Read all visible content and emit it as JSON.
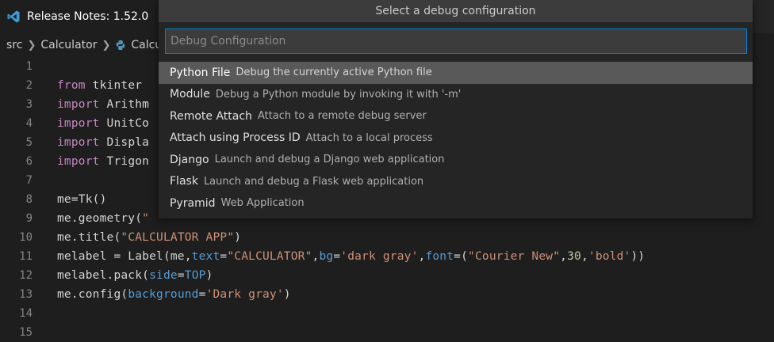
{
  "tab": {
    "title": "Release Notes: 1.52.0"
  },
  "breadcrumb": {
    "folder1": "src",
    "folder2": "Calculator",
    "file_partial": "Calcu"
  },
  "editor": {
    "lines": [
      {
        "n": "1",
        "segs": []
      },
      {
        "n": "2",
        "segs": [
          {
            "t": "from",
            "c": "kw"
          },
          {
            "t": " tkinter ",
            "c": ""
          }
        ]
      },
      {
        "n": "3",
        "segs": [
          {
            "t": "import",
            "c": "kw"
          },
          {
            "t": " Arithm",
            "c": ""
          }
        ]
      },
      {
        "n": "4",
        "segs": [
          {
            "t": "import",
            "c": "kw"
          },
          {
            "t": " UnitCo",
            "c": ""
          }
        ]
      },
      {
        "n": "5",
        "segs": [
          {
            "t": "import",
            "c": "kw"
          },
          {
            "t": " Displa",
            "c": ""
          }
        ]
      },
      {
        "n": "6",
        "segs": [
          {
            "t": "import",
            "c": "kw"
          },
          {
            "t": " Trigon",
            "c": ""
          }
        ]
      },
      {
        "n": "7",
        "segs": []
      },
      {
        "n": "8",
        "segs": [
          {
            "t": "me=Tk()",
            "c": ""
          }
        ]
      },
      {
        "n": "9",
        "segs": [
          {
            "t": "me.geometry(",
            "c": ""
          },
          {
            "t": "\"",
            "c": "str"
          }
        ]
      },
      {
        "n": "10",
        "segs": [
          {
            "t": "me.title(",
            "c": ""
          },
          {
            "t": "\"CALCULATOR APP\"",
            "c": "str"
          },
          {
            "t": ")",
            "c": ""
          }
        ]
      },
      {
        "n": "11",
        "segs": [
          {
            "t": "melabel = Label(me,",
            "c": ""
          },
          {
            "t": "text",
            "c": "param"
          },
          {
            "t": "=",
            "c": ""
          },
          {
            "t": "\"CALCULATOR\"",
            "c": "str"
          },
          {
            "t": ",",
            "c": ""
          },
          {
            "t": "bg",
            "c": "param"
          },
          {
            "t": "=",
            "c": ""
          },
          {
            "t": "'dark gray'",
            "c": "str"
          },
          {
            "t": ",",
            "c": ""
          },
          {
            "t": "font",
            "c": "param"
          },
          {
            "t": "=(",
            "c": ""
          },
          {
            "t": "\"Courier New\"",
            "c": "str"
          },
          {
            "t": ",",
            "c": ""
          },
          {
            "t": "30",
            "c": "num"
          },
          {
            "t": ",",
            "c": ""
          },
          {
            "t": "'bold'",
            "c": "str"
          },
          {
            "t": "))",
            "c": ""
          }
        ]
      },
      {
        "n": "12",
        "segs": [
          {
            "t": "melabel.pack(",
            "c": ""
          },
          {
            "t": "side",
            "c": "param"
          },
          {
            "t": "=",
            "c": ""
          },
          {
            "t": "TOP",
            "c": "param"
          },
          {
            "t": ")",
            "c": ""
          }
        ]
      },
      {
        "n": "13",
        "segs": [
          {
            "t": "me.config(",
            "c": ""
          },
          {
            "t": "background",
            "c": "param"
          },
          {
            "t": "=",
            "c": ""
          },
          {
            "t": "'Dark gray'",
            "c": "str"
          },
          {
            "t": ")",
            "c": ""
          }
        ]
      },
      {
        "n": "14",
        "segs": []
      },
      {
        "n": "15",
        "segs": []
      }
    ]
  },
  "quickpick": {
    "title": "Select a debug configuration",
    "placeholder": "Debug Configuration",
    "items": [
      {
        "label": "Python File",
        "description": "Debug the currently active Python file",
        "active": true
      },
      {
        "label": "Module",
        "description": "Debug a Python module by invoking it with '-m'"
      },
      {
        "label": "Remote Attach",
        "description": "Attach to a remote debug server"
      },
      {
        "label": "Attach using Process ID",
        "description": "Attach to a local process"
      },
      {
        "label": "Django",
        "description": "Launch and debug a Django web application"
      },
      {
        "label": "Flask",
        "description": "Launch and debug a Flask web application"
      },
      {
        "label": "Pyramid",
        "description": "Web Application"
      }
    ]
  },
  "colors": {
    "accent": "#007fd4",
    "vscode_blue": "#3e9bd6",
    "python_blue": "#519aba"
  },
  "icons": {
    "tab": "vscode-logo-icon",
    "breadcrumb_file": "python-file-icon"
  }
}
